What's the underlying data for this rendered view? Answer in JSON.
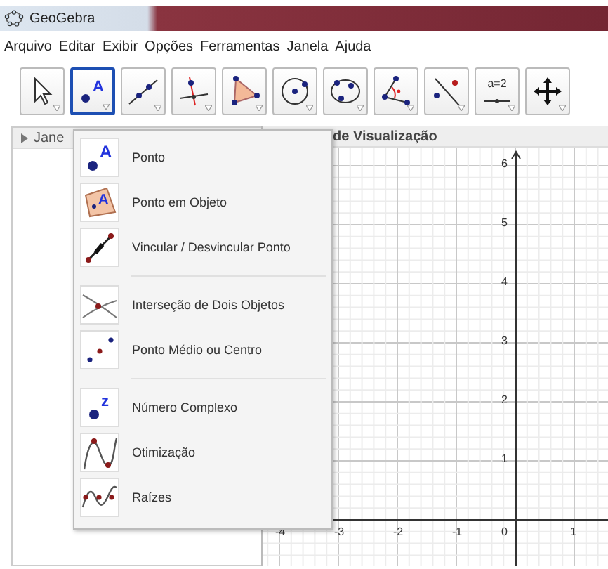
{
  "window": {
    "title": "GeoGebra"
  },
  "menu_bar": [
    "Arquivo",
    "Editar",
    "Exibir",
    "Opções",
    "Ferramentas",
    "Janela",
    "Ajuda"
  ],
  "toolbar": [
    {
      "selected": false
    },
    {
      "selected": true,
      "glyph": "A"
    },
    {
      "selected": false
    },
    {
      "selected": false
    },
    {
      "selected": false
    },
    {
      "selected": false
    },
    {
      "selected": false
    },
    {
      "selected": false
    },
    {
      "selected": false
    },
    {
      "selected": false,
      "label": "a=2"
    },
    {
      "selected": false
    }
  ],
  "algebra_panel": {
    "title": "Jane"
  },
  "graphics_panel": {
    "title": "de Visualização",
    "x_labels": [
      "-4",
      "-3",
      "-2",
      "-1",
      "0",
      "1"
    ],
    "y_labels": [
      "6",
      "5",
      "4",
      "3",
      "2",
      "1"
    ]
  },
  "tool_menu": {
    "groups": [
      {
        "items": [
          {
            "label": "Ponto",
            "glyph": "A"
          },
          {
            "label": "Ponto em Objeto",
            "glyph": "A"
          },
          {
            "label": "Vincular / Desvincular Ponto"
          }
        ]
      },
      {
        "items": [
          {
            "label": "Interseção de Dois Objetos"
          },
          {
            "label": "Ponto Médio ou Centro"
          }
        ]
      },
      {
        "items": [
          {
            "label": "Número Complexo",
            "glyph": "z"
          },
          {
            "label": "Otimização"
          },
          {
            "label": "Raízes"
          }
        ]
      }
    ]
  }
}
